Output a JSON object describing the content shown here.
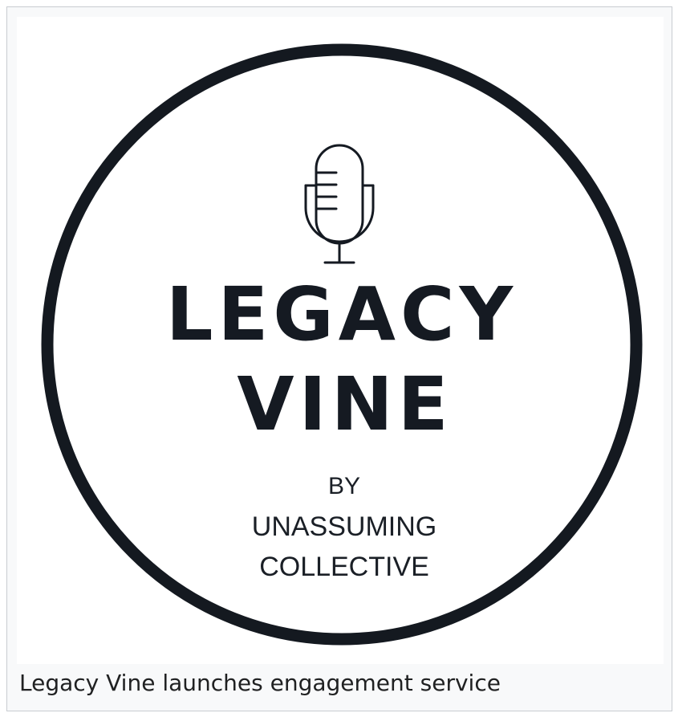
{
  "logo": {
    "title_line1": "LEGACY",
    "title_line2": "VINE",
    "sub_line1": "BY",
    "sub_line2": "UNASSUMING",
    "sub_line3": "COLLECTIVE",
    "ring_color": "#141920",
    "text_color": "#151a22",
    "icon": "microphone-icon"
  },
  "caption": {
    "text": "Legacy Vine launches engagement service"
  }
}
